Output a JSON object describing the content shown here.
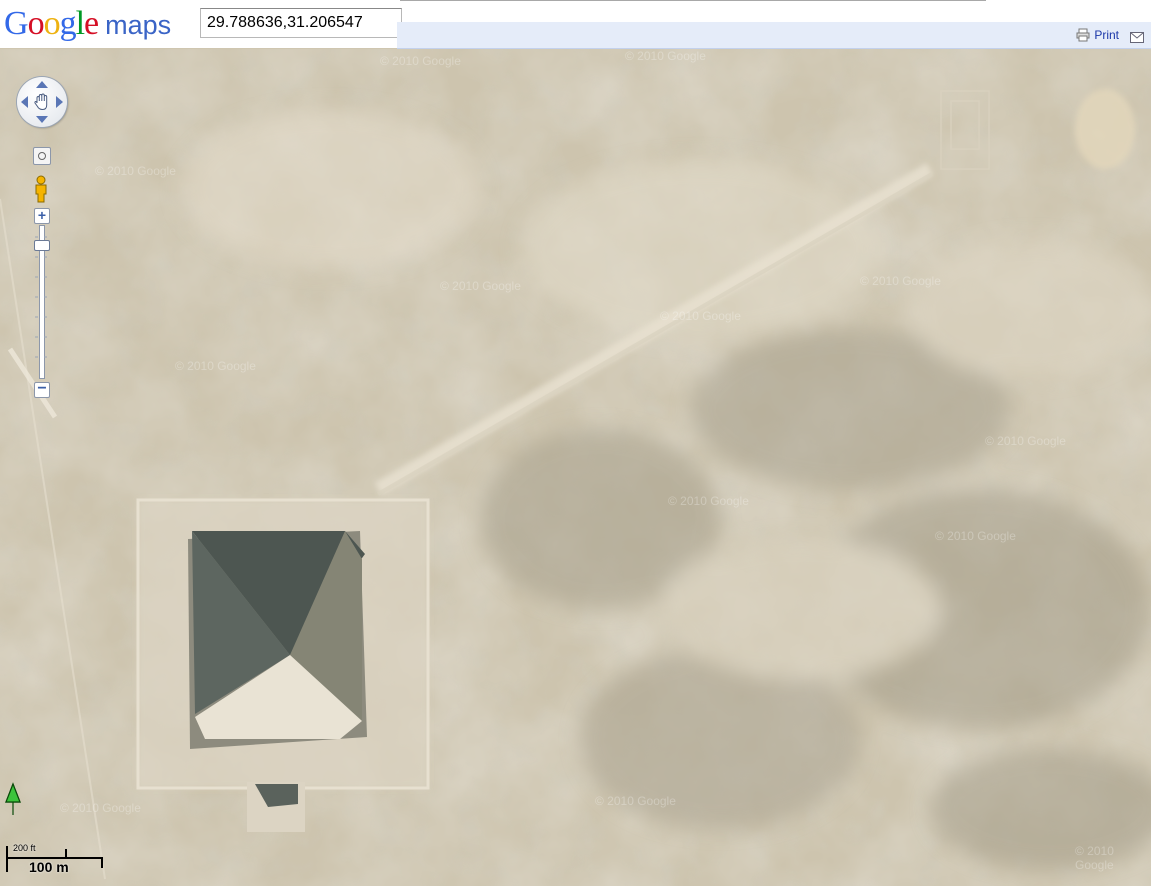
{
  "header": {
    "logo_letters": [
      {
        "char": "G",
        "color": "#3369e8"
      },
      {
        "char": "o",
        "color": "#d50f25"
      },
      {
        "char": "o",
        "color": "#eeb211"
      },
      {
        "char": "g",
        "color": "#3369e8"
      },
      {
        "char": "l",
        "color": "#009925"
      },
      {
        "char": "e",
        "color": "#d50f25"
      }
    ],
    "logo_maps": "maps",
    "search_value": "29.788636,31.206547",
    "print_label": "Print",
    "print_icon": "printer-icon",
    "mail_icon": "envelope-icon"
  },
  "map": {
    "view": "satellite",
    "watermark": "© 2010 Google",
    "controls": {
      "pan_icon": "hand-icon",
      "zoom_in": "+",
      "zoom_out": "−",
      "streetview_icon": "pegman-icon",
      "north_icon": "north-arrow-icon"
    },
    "scale": {
      "imperial": "200 ft",
      "metric": "100 m"
    }
  }
}
